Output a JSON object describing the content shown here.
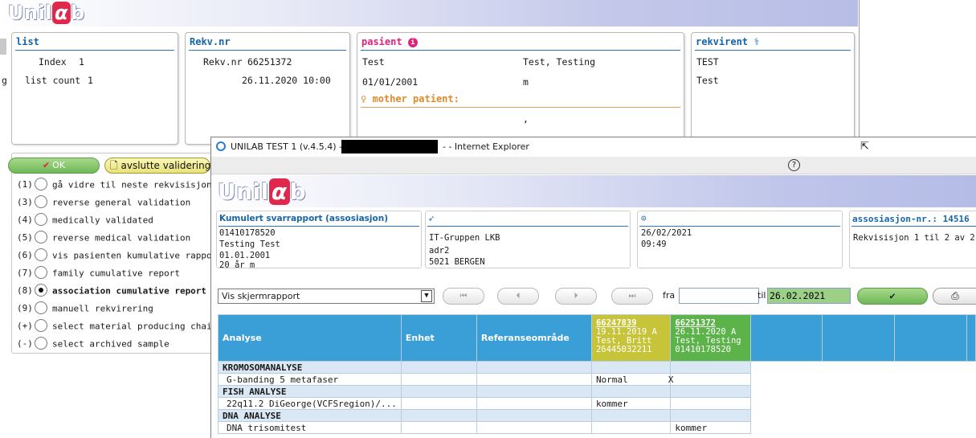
{
  "background": {
    "logo": {
      "prefix": "Unil",
      "alpha": "α",
      "suffix": "b"
    },
    "list_panel": {
      "title": "list",
      "index_label": "Index",
      "index_value": "1",
      "count_label": "list count",
      "count_value": "1"
    },
    "rekv_panel": {
      "title": "Rekv.nr",
      "rekv_label": "Rekv.nr",
      "rekv_value": "66251372",
      "datetime": "26.11.2020 10:00"
    },
    "pasient_panel": {
      "title": "pasient",
      "surname": "Test",
      "fullname": "Test, Testing",
      "dob": "01/01/2001",
      "sex": "m",
      "mother_title": "mother patient:",
      "mother_value": ","
    },
    "rekvirent_panel": {
      "title": "rekvirent",
      "line1": "TEST",
      "line2": "Test"
    },
    "edge_text": "g"
  },
  "validation": {
    "ok_label": "OK",
    "close_label": "avslutte validering",
    "options": [
      {
        "key": "(1)",
        "label": "gå vidre til neste rekvisisjon",
        "selected": false
      },
      {
        "key": "(3)",
        "label": "reverse general validation",
        "selected": false
      },
      {
        "key": "(4)",
        "label": "medically validated",
        "selected": false
      },
      {
        "key": "(5)",
        "label": "reverse medical validation",
        "selected": false
      },
      {
        "key": "(6)",
        "label": "vis pasienten kumulative rapport",
        "selected": false
      },
      {
        "key": "(7)",
        "label": "family cumulative report",
        "selected": false
      },
      {
        "key": "(8)",
        "label": "association cumulative report",
        "selected": true
      },
      {
        "key": "(9)",
        "label": "manuell rekvirering",
        "selected": false
      },
      {
        "key": "(+)",
        "label": "select material producing chain",
        "selected": false
      },
      {
        "key": "(-)",
        "label": "select archived sample",
        "selected": false
      }
    ]
  },
  "ie": {
    "title_prefix": "UNILAB TEST 1 (v.4.5.4) -",
    "title_suffix": "- - Internet Explorer",
    "help_icon": "?",
    "report_panel": {
      "title": "Kumulert svarrapport (assosiasjon)",
      "l1": "01410178520",
      "l2": "Testing  Test",
      "l3": "01.01.2001",
      "l4": "20 år  m"
    },
    "sender_panel": {
      "l1": "IT-Gruppen LKB",
      "l2": "adr2",
      "l3": "5021 BERGEN"
    },
    "time_panel": {
      "l1": "26/02/2021",
      "l2": "09:49"
    },
    "assoc_panel": {
      "title": "assosiasjon-nr.: 14516",
      "l1": "Rekvisisjon 1 til 2 av 2"
    },
    "select_value": "Vis skjermrapport",
    "fra_label": "fra",
    "fra_value": "",
    "til_label": "til",
    "til_value": "26.02.2021",
    "table": {
      "headers": [
        "Analyse",
        "Enhet",
        "Referanseområde"
      ],
      "sample1": {
        "id": "66247839",
        "date": "19.11.2019  A",
        "name": "Test, Britt",
        "pid": "26445032211"
      },
      "sample2": {
        "id": "66251372",
        "date": "26.11.2020  A",
        "name": "Test, Testing",
        "pid": "01410178520"
      },
      "rows": [
        {
          "type": "section",
          "analyse": "KROMOSOMANALYSE"
        },
        {
          "type": "row",
          "analyse": "G-banding 5 metafaser",
          "v1": "Normal",
          "flag1": "X",
          "v2": ""
        },
        {
          "type": "section",
          "analyse": "FISH ANALYSE"
        },
        {
          "type": "row",
          "analyse": "22q11.2 DiGeorge(VCFSregion)/...",
          "v1": "kommer",
          "flag1": "",
          "v2": ""
        },
        {
          "type": "section",
          "analyse": "DNA ANALYSE"
        },
        {
          "type": "row",
          "analyse": "DNA trisomitest",
          "v1": "",
          "flag1": "",
          "v2": "kommer"
        }
      ]
    }
  },
  "colors": {
    "accent": "#1565a8",
    "mother": "#e28a2a",
    "sample1": "#c7c43a",
    "sample2": "#5cb34a",
    "header": "#3a9fd6"
  }
}
